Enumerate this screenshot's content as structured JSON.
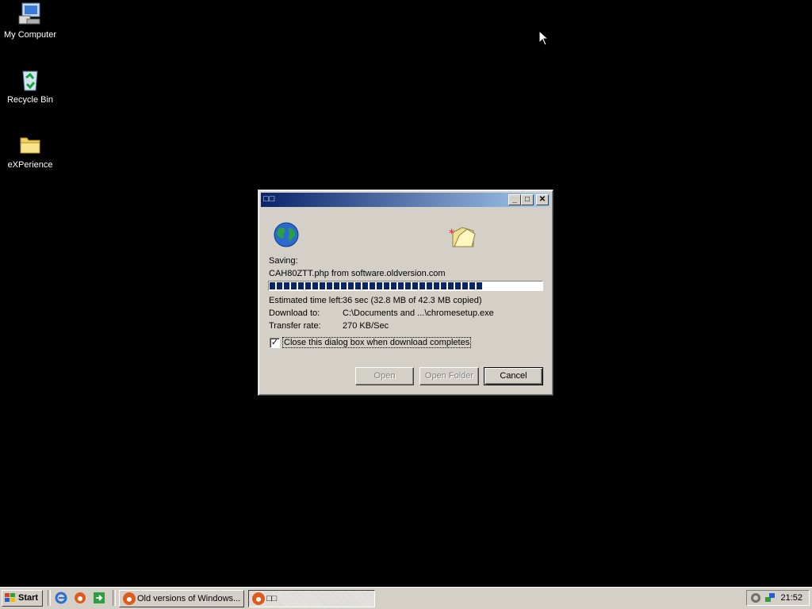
{
  "desktop": {
    "icons": [
      {
        "label": "My Computer",
        "icon": "my-computer-icon"
      },
      {
        "label": "Recycle Bin",
        "icon": "recycle-bin-icon"
      },
      {
        "label": "eXPerience",
        "icon": "folder-icon"
      }
    ]
  },
  "dialog": {
    "title": "□□",
    "saving_label": "Saving:",
    "file_source": "CAH80ZTT.php from software.oldversion.com",
    "progress_fraction": 0.78,
    "estimated_label": "Estimated time left:",
    "estimated_value": "36 sec (32.8 MB of 42.3 MB copied)",
    "download_to_label": "Download to:",
    "download_to_value": "C:\\Documents and ...\\chromesetup.exe",
    "transfer_rate_label": "Transfer rate:",
    "transfer_rate_value": "270 KB/Sec",
    "close_checkbox_label": "Close this dialog box when download completes",
    "close_checkbox_checked": true,
    "buttons": {
      "open": "Open",
      "open_folder": "Open Folder",
      "cancel": "Cancel"
    }
  },
  "taskbar": {
    "start_label": "Start",
    "tasks": [
      {
        "label": "Old versions of Windows..."
      },
      {
        "label": "□□"
      }
    ],
    "clock": "21:52"
  },
  "colors": {
    "title_start": "#0a246a",
    "title_end": "#a6caf0",
    "progress": "#0a246a",
    "face": "#d4d0c8"
  }
}
